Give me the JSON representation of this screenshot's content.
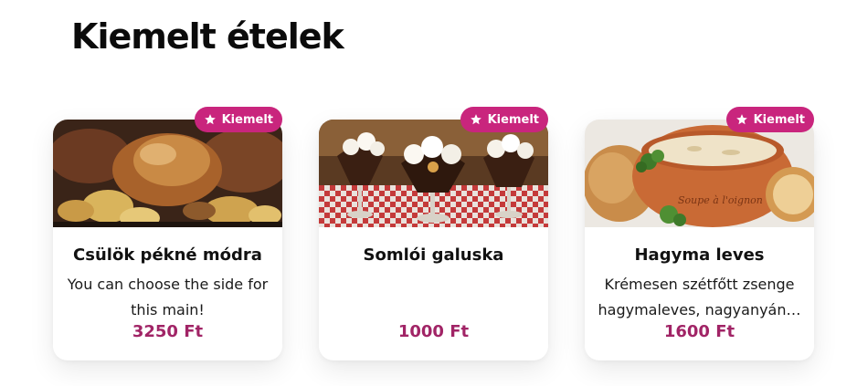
{
  "section": {
    "title": "Kiemelt ételek"
  },
  "colors": {
    "badge": "#c9257d",
    "price": "#a12466"
  },
  "cards": [
    {
      "badge_label": "Kiemelt",
      "badge_icon": "star-icon",
      "image": "roasted-pork-knuckle-photo",
      "title": "Csülök pékné módra",
      "description": "You can choose the side for this main!",
      "price": "3250 Ft"
    },
    {
      "badge_label": "Kiemelt",
      "badge_icon": "star-icon",
      "image": "somloi-dessert-photo",
      "title": "Somlói galuska",
      "description": "",
      "price": "1000 Ft"
    },
    {
      "badge_label": "Kiemelt",
      "badge_icon": "star-icon",
      "image": "onion-soup-photo",
      "title": "Hagyma leves",
      "description": "Krémesen szétfőtt zsenge hagymaleves, nagyanyán…",
      "price": "1600 Ft"
    }
  ]
}
